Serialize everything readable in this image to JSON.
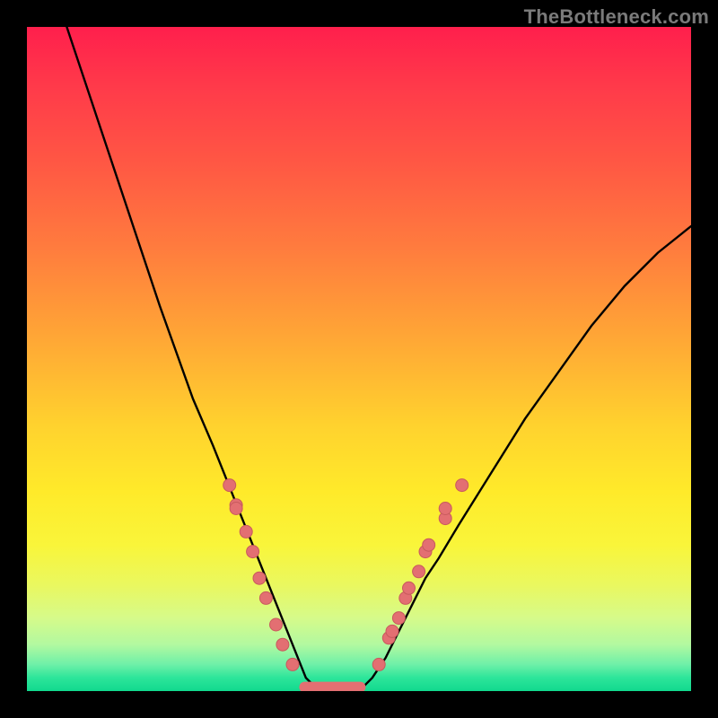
{
  "watermark": "TheBottleneck.com",
  "colors": {
    "background": "#000000",
    "curve": "#000000",
    "marker": "#e36f72",
    "gradient_top": "#ff1f4c",
    "gradient_bottom": "#11d98e"
  },
  "chart_data": {
    "type": "line",
    "title": "",
    "xlabel": "",
    "ylabel": "",
    "xlim": [
      0,
      100
    ],
    "ylim": [
      0,
      100
    ],
    "grid": false,
    "legend": false,
    "description": "Single V-shaped bottleneck curve over a vertical red-to-green gradient. Lower y = less bottleneck (green). Minimum plateau near x≈42–50 at y≈0.",
    "series": [
      {
        "name": "bottleneck",
        "x": [
          6,
          10,
          15,
          20,
          25,
          28,
          30,
          32,
          34,
          36,
          38,
          40,
          42,
          44,
          46,
          48,
          50,
          52,
          54,
          56,
          58,
          60,
          62,
          65,
          70,
          75,
          80,
          85,
          90,
          95,
          100
        ],
        "y": [
          100,
          88,
          73,
          58,
          44,
          37,
          32,
          27,
          22,
          17,
          12,
          7,
          2,
          0,
          0,
          0,
          0,
          2,
          5,
          9,
          13,
          17,
          20,
          25,
          33,
          41,
          48,
          55,
          61,
          66,
          70
        ]
      }
    ],
    "markers_left": [
      [
        30.5,
        31
      ],
      [
        31.5,
        28
      ],
      [
        31.5,
        27.5
      ],
      [
        33,
        24
      ],
      [
        34,
        21
      ],
      [
        35,
        17
      ],
      [
        36,
        14
      ],
      [
        37.5,
        10
      ],
      [
        38.5,
        7
      ],
      [
        40,
        4
      ]
    ],
    "markers_right": [
      [
        53,
        4
      ],
      [
        54.5,
        8
      ],
      [
        55,
        9
      ],
      [
        56,
        11
      ],
      [
        57,
        14
      ],
      [
        57.5,
        15.5
      ],
      [
        59,
        18
      ],
      [
        60,
        21
      ],
      [
        60.5,
        22
      ],
      [
        63,
        26
      ],
      [
        63,
        27.5
      ],
      [
        65.5,
        31
      ]
    ],
    "plateau": {
      "x_start": 41,
      "x_end": 51,
      "y": 0.6
    }
  }
}
